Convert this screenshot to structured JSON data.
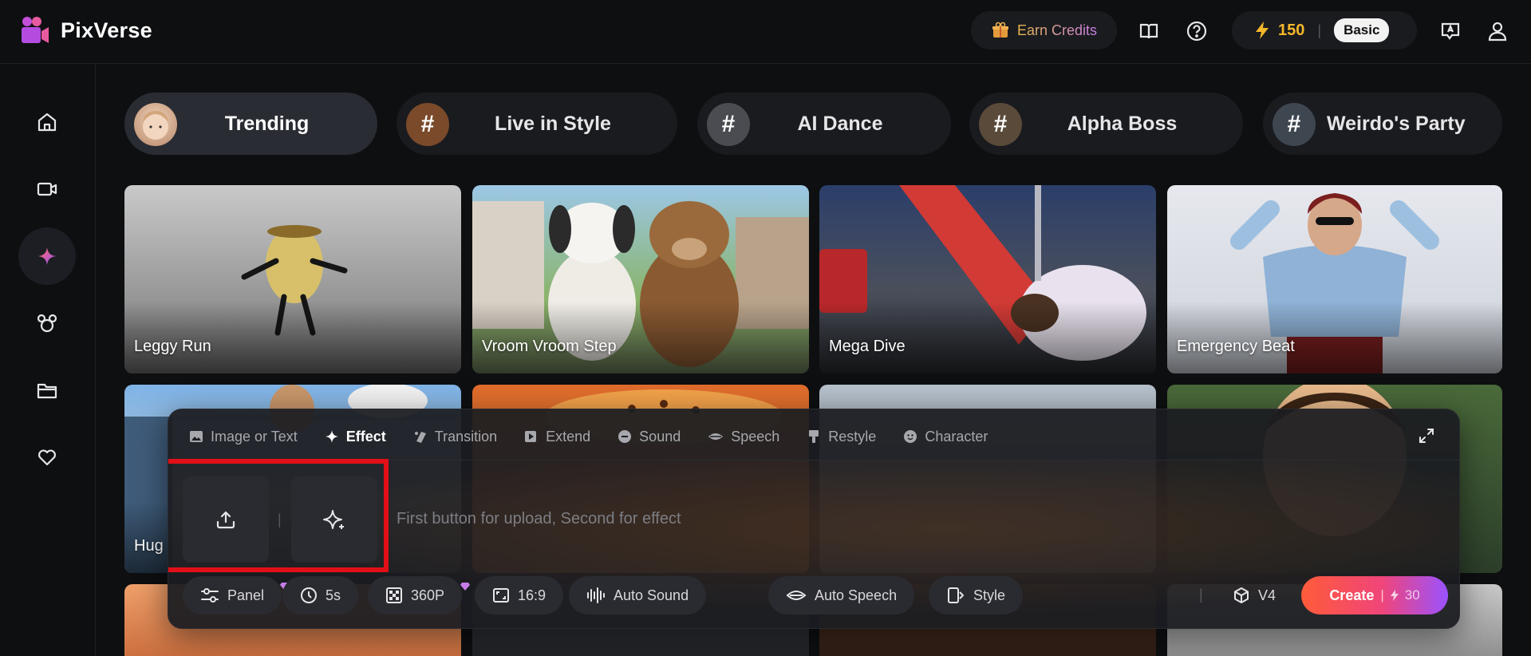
{
  "app": {
    "name": "PixVerse"
  },
  "header": {
    "earn_credits": "Earn Credits",
    "credits": "150",
    "plan": "Basic"
  },
  "sidebar": {
    "items": [
      {
        "name": "home",
        "icon": "home-icon"
      },
      {
        "name": "video",
        "icon": "video-icon"
      },
      {
        "name": "effects",
        "icon": "sparkle-icon",
        "active": true
      },
      {
        "name": "characters",
        "icon": "mouse-ears-icon"
      },
      {
        "name": "folder",
        "icon": "folder-icon"
      },
      {
        "name": "favorites",
        "icon": "heart-icon"
      }
    ]
  },
  "tabs": [
    {
      "label": "Trending",
      "active": true
    },
    {
      "label": "Live in Style"
    },
    {
      "label": "AI Dance"
    },
    {
      "label": "Alpha Boss"
    },
    {
      "label": "Weirdo's Party"
    }
  ],
  "cards": [
    {
      "title": "Leggy Run"
    },
    {
      "title": "Vroom Vroom Step"
    },
    {
      "title": "Mega Dive"
    },
    {
      "title": "Emergency Beat"
    },
    {
      "title": "Hug"
    }
  ],
  "composer": {
    "modes": [
      {
        "label": "Image or Text",
        "icon": "image-icon"
      },
      {
        "label": "Effect",
        "icon": "sparkle-icon",
        "active": true
      },
      {
        "label": "Transition",
        "icon": "transition-icon"
      },
      {
        "label": "Extend",
        "icon": "extend-icon"
      },
      {
        "label": "Sound",
        "icon": "sound-icon"
      },
      {
        "label": "Speech",
        "icon": "lips-icon"
      },
      {
        "label": "Restyle",
        "icon": "brush-icon"
      },
      {
        "label": "Character",
        "icon": "face-icon"
      }
    ],
    "slot_separator": "|",
    "prompt_placeholder": "First button for upload, Second for effect",
    "options": {
      "panel": "Panel",
      "duration": "5s",
      "quality": "360P",
      "ratio": "16:9",
      "auto_sound": "Auto Sound",
      "auto_speech": "Auto Speech",
      "style": "Style"
    },
    "model": "V4",
    "create": {
      "label": "Create",
      "cost": "30"
    }
  },
  "colors": {
    "accent_orange": "#ff5b3a",
    "accent_purple": "#9a52ff",
    "credit_gold": "#f5b82a",
    "highlight_red": "#e10f17"
  }
}
